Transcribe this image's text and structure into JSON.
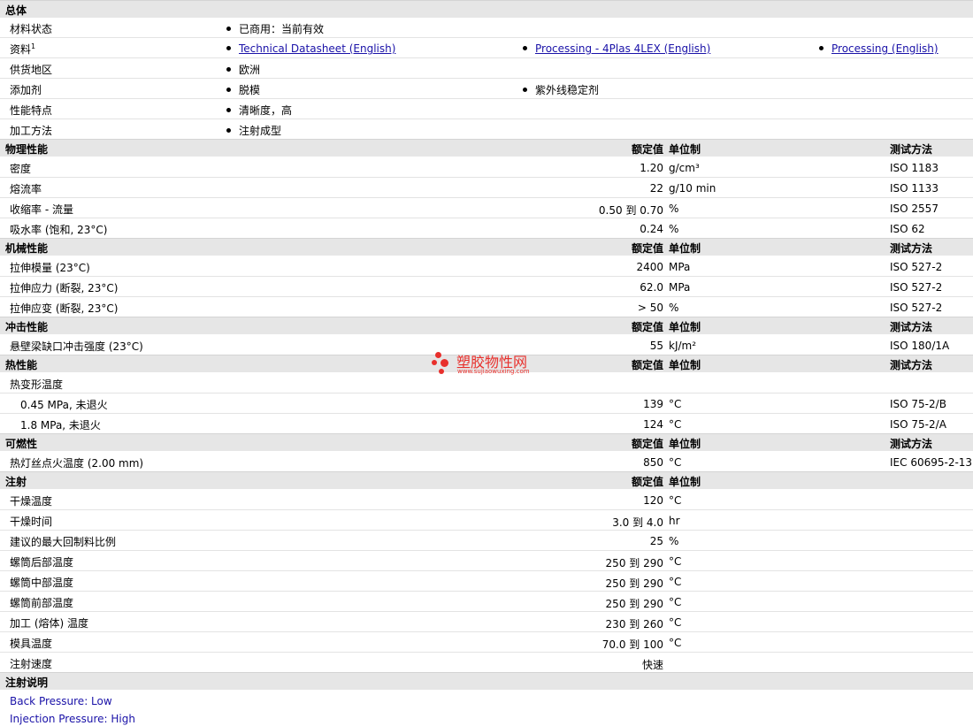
{
  "general": {
    "title": "总体",
    "rows": [
      {
        "label": "材料状态",
        "items": [
          "已商用：当前有效"
        ]
      },
      {
        "label": "资料",
        "sup": "1",
        "links": [
          "Technical Datasheet (English)",
          "Processing - 4Plas 4LEX (English)",
          "Processing (English)"
        ]
      },
      {
        "label": "供货地区",
        "items": [
          "欧洲"
        ]
      },
      {
        "label": "添加剂",
        "items": [
          "脱模",
          "紫外线稳定剂"
        ]
      },
      {
        "label": "性能特点",
        "items": [
          "清晰度，高"
        ]
      },
      {
        "label": "加工方法",
        "items": [
          "注射成型"
        ]
      }
    ]
  },
  "columns": {
    "value": "额定值",
    "unit": "单位制",
    "test": "测试方法"
  },
  "physical": {
    "title": "物理性能",
    "rows": [
      {
        "label": "密度",
        "value": "1.20",
        "unit": "g/cm³",
        "test": "ISO 1183"
      },
      {
        "label": "熔流率",
        "value": "22",
        "unit": "g/10 min",
        "test": "ISO 1133"
      },
      {
        "label": "收缩率 - 流量",
        "value": "0.50 到  0.70",
        "unit": "%",
        "test": "ISO 2557"
      },
      {
        "label": "吸水率 (饱和, 23°C)",
        "value": "0.24",
        "unit": "%",
        "test": "ISO 62"
      }
    ]
  },
  "mechanical": {
    "title": "机械性能",
    "rows": [
      {
        "label": "拉伸模量 (23°C)",
        "value": "2400",
        "unit": "MPa",
        "test": "ISO 527-2"
      },
      {
        "label": "拉伸应力 (断裂, 23°C)",
        "value": "62.0",
        "unit": "MPa",
        "test": "ISO 527-2"
      },
      {
        "label": "拉伸应变 (断裂, 23°C)",
        "value": "> 50",
        "unit": "%",
        "test": "ISO 527-2"
      }
    ]
  },
  "impact": {
    "title": "冲击性能",
    "rows": [
      {
        "label": "悬壁梁缺口冲击强度 (23°C)",
        "value": "55",
        "unit": "kJ/m²",
        "test": "ISO 180/1A"
      }
    ]
  },
  "thermal": {
    "title": "热性能",
    "rows": [
      {
        "label": "热变形温度",
        "value": "",
        "unit": "",
        "test": ""
      },
      {
        "label": "0.45 MPa, 未退火",
        "value": "139",
        "unit": "°C",
        "test": "ISO 75-2/B",
        "sub": true
      },
      {
        "label": "1.8 MPa, 未退火",
        "value": "124",
        "unit": "°C",
        "test": "ISO 75-2/A",
        "sub": true
      }
    ]
  },
  "flammability": {
    "title": "可燃性",
    "rows": [
      {
        "label": "热灯丝点火温度 (2.00 mm)",
        "value": "850",
        "unit": "°C",
        "test": "IEC 60695-2-13"
      }
    ]
  },
  "injection": {
    "title": "注射",
    "rows": [
      {
        "label": "干燥温度",
        "value": "120",
        "unit": "°C"
      },
      {
        "label": "干燥时间",
        "value": "3.0 到  4.0",
        "unit": "hr"
      },
      {
        "label": "建议的最大回制料比例",
        "value": "25",
        "unit": "%"
      },
      {
        "label": "螺筒后部温度",
        "value": "250 到  290",
        "unit": "°C"
      },
      {
        "label": "螺筒中部温度",
        "value": "250 到  290",
        "unit": "°C"
      },
      {
        "label": "螺筒前部温度",
        "value": "250 到  290",
        "unit": "°C"
      },
      {
        "label": "加工 (熔体) 温度",
        "value": "230 到  260",
        "unit": "°C"
      },
      {
        "label": "模具温度",
        "value": "70.0 到  100",
        "unit": "°C"
      },
      {
        "label": "注射速度",
        "value": "快速",
        "unit": ""
      }
    ]
  },
  "injection_notes": {
    "title": "注射说明",
    "lines": [
      "Back Pressure: Low",
      "Injection Pressure: High"
    ]
  },
  "watermark": {
    "name": "塑胶物性网",
    "url": "www.sujiaowuxing.com"
  },
  "colors": {
    "header_bg": "#e6e6e6",
    "link": "#1a12a8",
    "watermark": "#e8302c"
  }
}
